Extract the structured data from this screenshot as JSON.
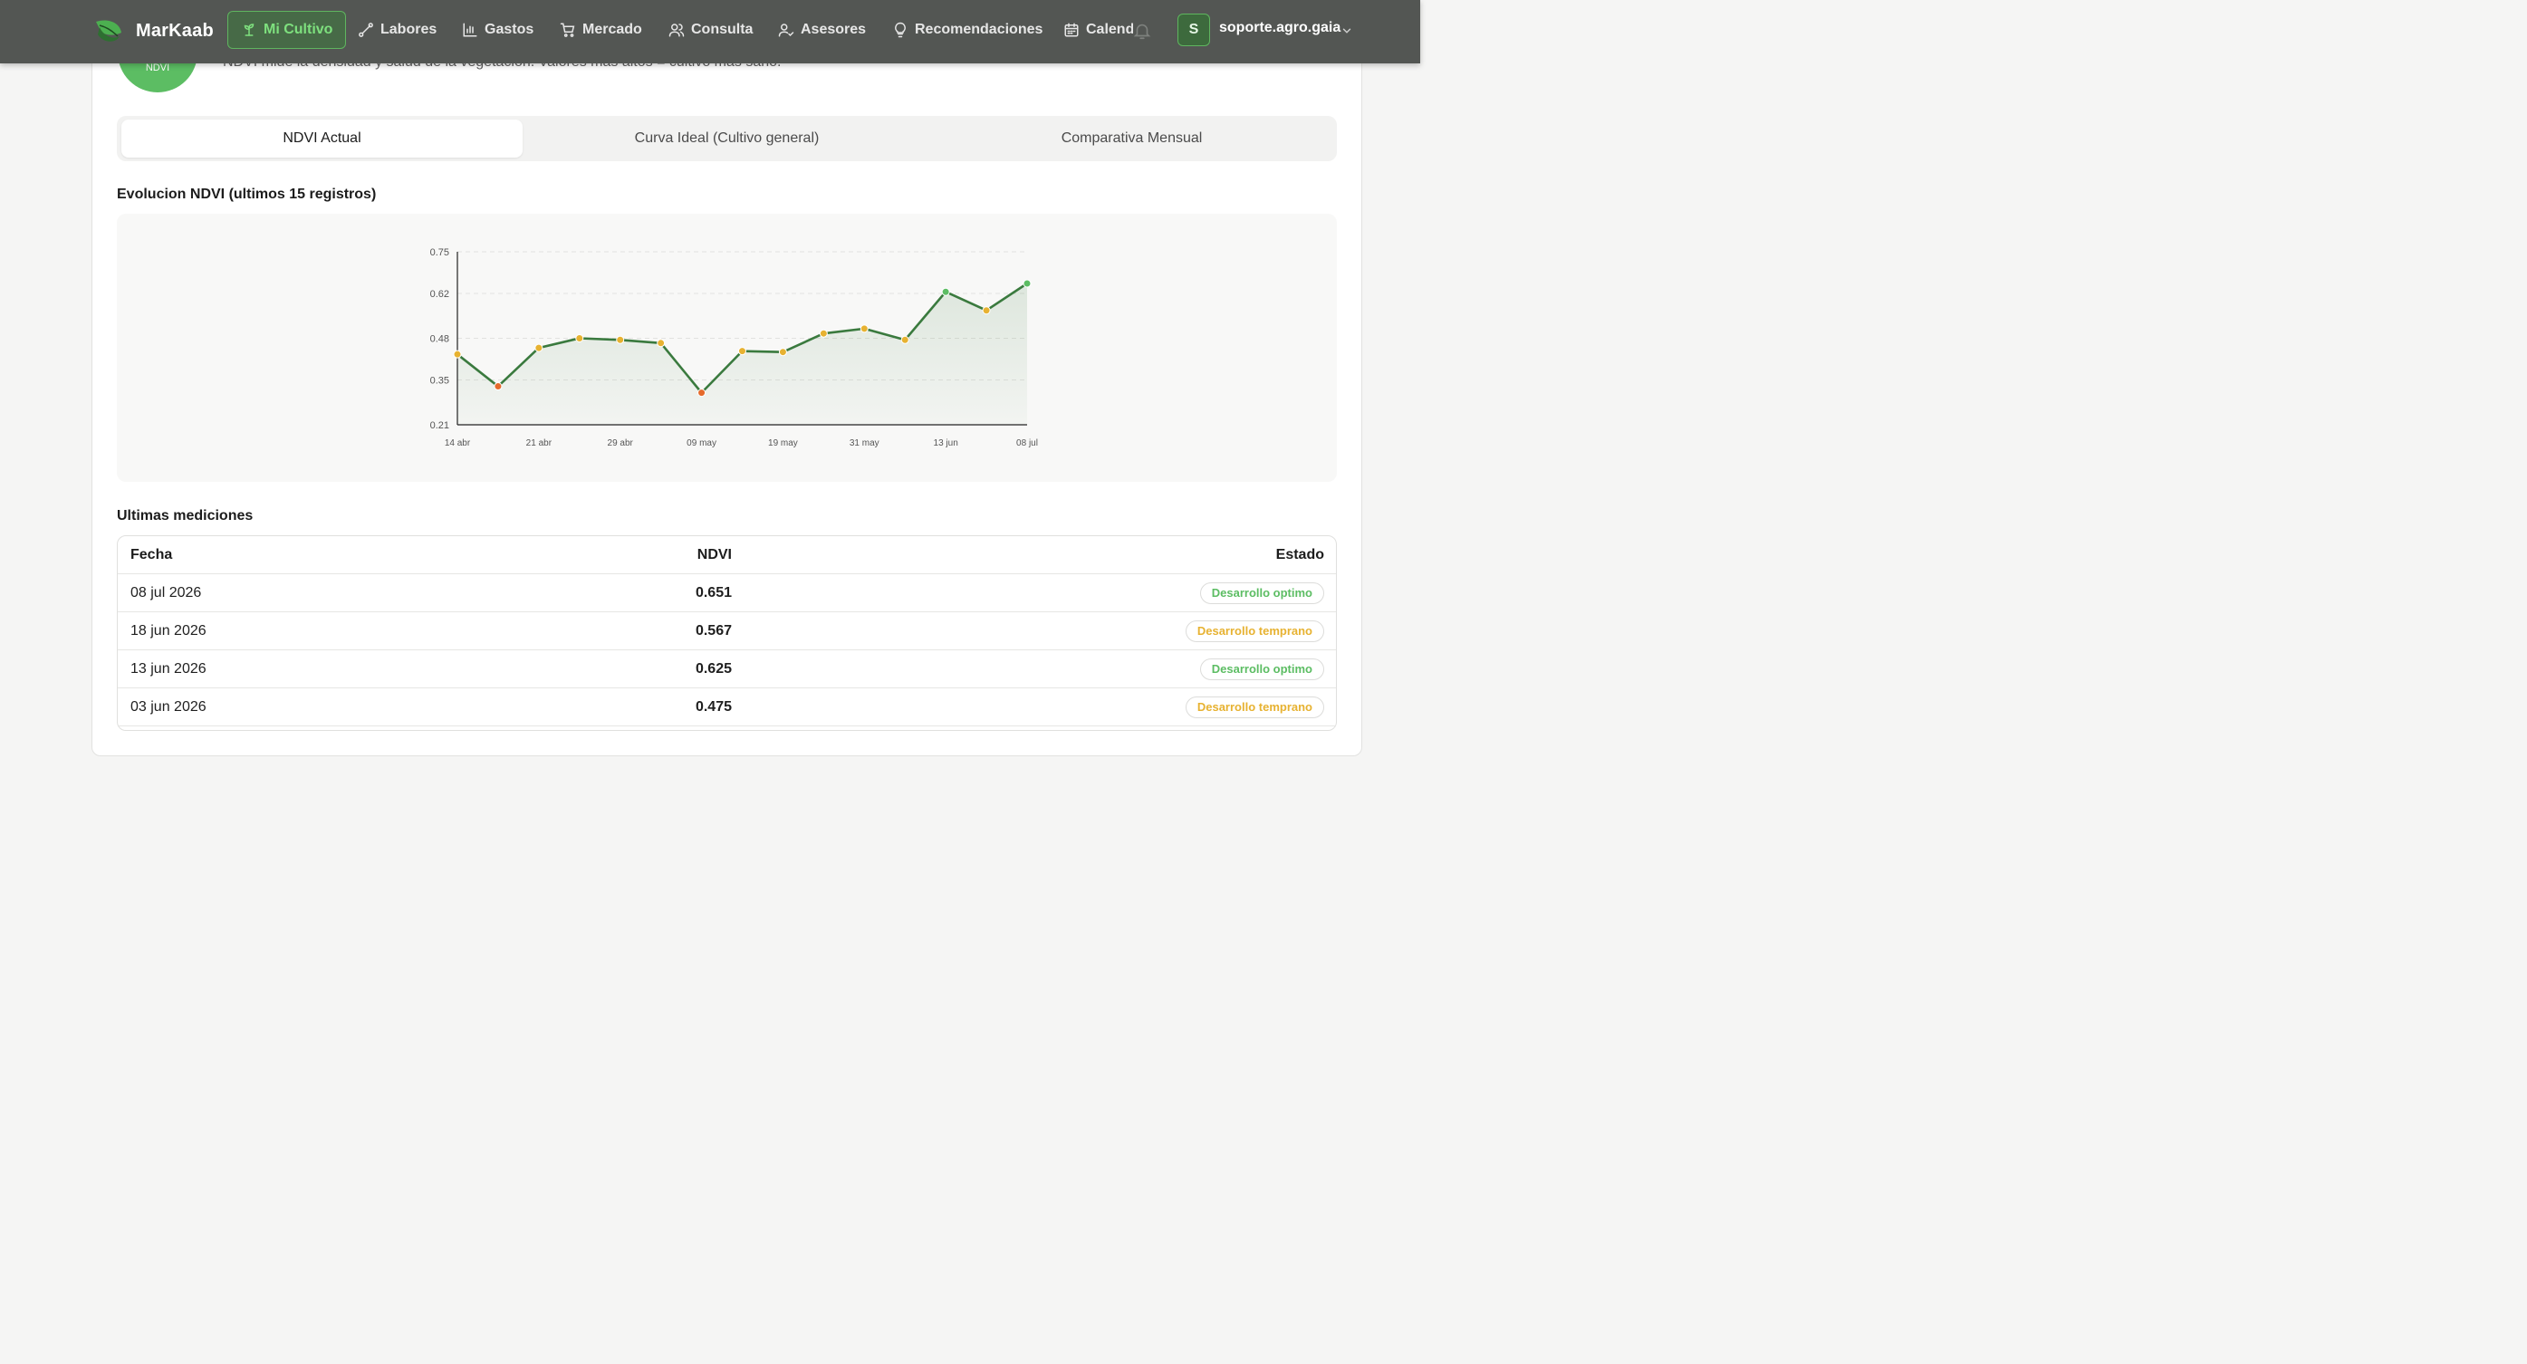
{
  "brand": {
    "name": "MarKaab"
  },
  "nav": {
    "items": [
      {
        "label": "Mi Cultivo",
        "icon": "sprout-icon"
      },
      {
        "label": "Labores",
        "icon": "tool-icon"
      },
      {
        "label": "Gastos",
        "icon": "bar-chart-icon"
      },
      {
        "label": "Mercado",
        "icon": "cart-icon"
      },
      {
        "label": "Consulta",
        "icon": "users-icon"
      },
      {
        "label": "Asesores",
        "icon": "user-check-icon"
      },
      {
        "label": "Recomendaciones",
        "icon": "lightbulb-icon"
      },
      {
        "label": "Calendario",
        "icon": "calendar-icon"
      }
    ]
  },
  "user": {
    "initial": "S",
    "name": "soporte.agro.gaia"
  },
  "indicator": {
    "badge": "NDVI",
    "description": "NDVI mide la densidad y salud de la vegetacion. Valores mas altos = cultivo mas sano."
  },
  "tabs": [
    "NDVI Actual",
    "Curva Ideal (Cultivo general)",
    "Comparativa Mensual"
  ],
  "chart_title": "Evolucion NDVI (ultimos 15 registros)",
  "chart_data": {
    "type": "line",
    "ylim": [
      0.21,
      0.75
    ],
    "yticks": [
      "0.75",
      "0.62",
      "0.48",
      "0.35",
      "0.21"
    ],
    "xtick_labels": [
      "14 abr",
      "21 abr",
      "29 abr",
      "09 may",
      "19 may",
      "31 may",
      "13 jun",
      "08 jul"
    ],
    "x": [
      "14 abr",
      "18 abr",
      "21 abr",
      "24 abr",
      "29 abr",
      "03 may",
      "09 may",
      "14 may",
      "19 may",
      "24 may",
      "31 may",
      "03 jun",
      "13 jun",
      "18 jun",
      "08 jul"
    ],
    "values": [
      0.43,
      0.33,
      0.45,
      0.48,
      0.475,
      0.465,
      0.31,
      0.44,
      0.437,
      0.495,
      0.51,
      0.475,
      0.625,
      0.567,
      0.651
    ],
    "grid": true,
    "colors": {
      "line": "#3a7a3e",
      "optimo": "#5cbd63",
      "temprano": "#e7b231",
      "bajo": "#e56a2c"
    }
  },
  "table": {
    "title": "Ultimas mediciones",
    "headers": {
      "date": "Fecha",
      "ndvi": "NDVI",
      "state": "Estado"
    },
    "rows": [
      {
        "date": "08 jul 2026",
        "ndvi": "0.651",
        "state": "Desarrollo optimo",
        "status": "optimo"
      },
      {
        "date": "18 jun 2026",
        "ndvi": "0.567",
        "state": "Desarrollo temprano",
        "status": "temprano"
      },
      {
        "date": "13 jun 2026",
        "ndvi": "0.625",
        "state": "Desarrollo optimo",
        "status": "optimo"
      },
      {
        "date": "03 jun 2026",
        "ndvi": "0.475",
        "state": "Desarrollo temprano",
        "status": "temprano"
      }
    ]
  }
}
